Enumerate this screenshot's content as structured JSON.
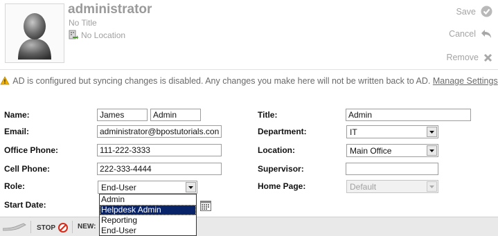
{
  "header": {
    "name": "administrator",
    "title": "No Title",
    "location": "No Location",
    "actions": {
      "save": "Save",
      "cancel": "Cancel",
      "remove": "Remove"
    }
  },
  "warning": {
    "message": "AD is configured but syncing changes is disabled. Any changes you make here will not be written back to AD.",
    "link": "Manage Settings"
  },
  "form": {
    "name_label": "Name:",
    "first_name": "James",
    "last_name": "Admin",
    "email_label": "Email:",
    "email": "administrator@bpostutorials.con",
    "office_phone_label": "Office Phone:",
    "office_phone": "111-222-3333",
    "cell_phone_label": "Cell Phone:",
    "cell_phone": "222-333-4444",
    "role_label": "Role:",
    "role": "End-User",
    "start_date_label": "Start Date:",
    "title_label": "Title:",
    "title": "Admin",
    "department_label": "Department:",
    "department": "IT",
    "location_label": "Location:",
    "location": "Main Office",
    "supervisor_label": "Supervisor:",
    "supervisor": "",
    "home_page_label": "Home Page:",
    "home_page": "Default"
  },
  "role_dropdown": {
    "options": [
      "Admin",
      "Helpdesk Admin",
      "Reporting",
      "End-User"
    ],
    "highlighted": "Helpdesk Admin"
  },
  "bottom_bar": {
    "stop": "STOP",
    "new": "NEW:"
  },
  "colors": {
    "highlight": "#0a246a",
    "header_text": "#9a9a9a",
    "warning_icon": "#f2b300",
    "stop_icon": "#d42a1a"
  }
}
